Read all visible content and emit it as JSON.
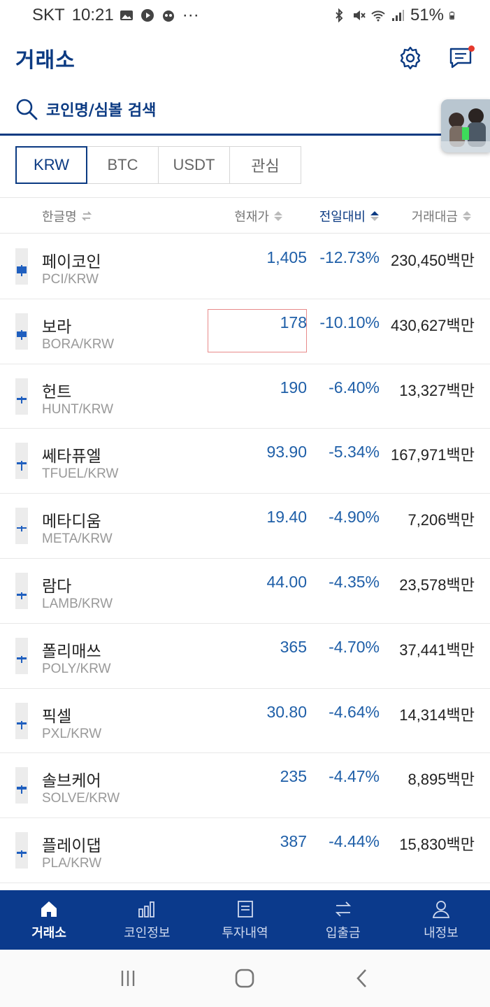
{
  "status_bar": {
    "carrier": "SKT",
    "time": "10:21",
    "more": "···",
    "battery": "51%"
  },
  "header": {
    "title": "거래소"
  },
  "search": {
    "placeholder": "코인명/심볼 검색"
  },
  "market_tabs": [
    {
      "label": "KRW",
      "active": true
    },
    {
      "label": "BTC",
      "active": false
    },
    {
      "label": "USDT",
      "active": false
    },
    {
      "label": "관심",
      "active": false
    }
  ],
  "columns": {
    "name": "한글명",
    "price": "현재가",
    "change": "전일대비",
    "volume": "거래대금"
  },
  "coins": [
    {
      "name": "페이코인",
      "symbol": "PCI/KRW",
      "price": "1,405",
      "change": "-12.73%",
      "volume": "230,450",
      "unit": "백만"
    },
    {
      "name": "보라",
      "symbol": "BORA/KRW",
      "price": "178",
      "change": "-10.10%",
      "volume": "430,627",
      "unit": "백만"
    },
    {
      "name": "헌트",
      "symbol": "HUNT/KRW",
      "price": "190",
      "change": "-6.40%",
      "volume": "13,327",
      "unit": "백만"
    },
    {
      "name": "쎄타퓨엘",
      "symbol": "TFUEL/KRW",
      "price": "93.90",
      "change": "-5.34%",
      "volume": "167,971",
      "unit": "백만"
    },
    {
      "name": "메타디움",
      "symbol": "META/KRW",
      "price": "19.40",
      "change": "-4.90%",
      "volume": "7,206",
      "unit": "백만"
    },
    {
      "name": "람다",
      "symbol": "LAMB/KRW",
      "price": "44.00",
      "change": "-4.35%",
      "volume": "23,578",
      "unit": "백만"
    },
    {
      "name": "폴리매쓰",
      "symbol": "POLY/KRW",
      "price": "365",
      "change": "-4.70%",
      "volume": "37,441",
      "unit": "백만"
    },
    {
      "name": "픽셀",
      "symbol": "PXL/KRW",
      "price": "30.80",
      "change": "-4.64%",
      "volume": "14,314",
      "unit": "백만"
    },
    {
      "name": "솔브케어",
      "symbol": "SOLVE/KRW",
      "price": "235",
      "change": "-4.47%",
      "volume": "8,895",
      "unit": "백만"
    },
    {
      "name": "플레이댑",
      "symbol": "PLA/KRW",
      "price": "387",
      "change": "-4.44%",
      "volume": "15,830",
      "unit": "백만"
    }
  ],
  "bottom_nav": [
    {
      "label": "거래소",
      "icon": "home-icon",
      "active": true
    },
    {
      "label": "코인정보",
      "icon": "chart-icon",
      "active": false
    },
    {
      "label": "투자내역",
      "icon": "document-icon",
      "active": false
    },
    {
      "label": "입출금",
      "icon": "transfer-icon",
      "active": false
    },
    {
      "label": "내정보",
      "icon": "user-icon",
      "active": false
    }
  ],
  "colors": {
    "brand": "#0b3a82",
    "fall": "#1f5fa8",
    "nav_bg": "#0b3a8c",
    "notification": "#e5392c"
  }
}
